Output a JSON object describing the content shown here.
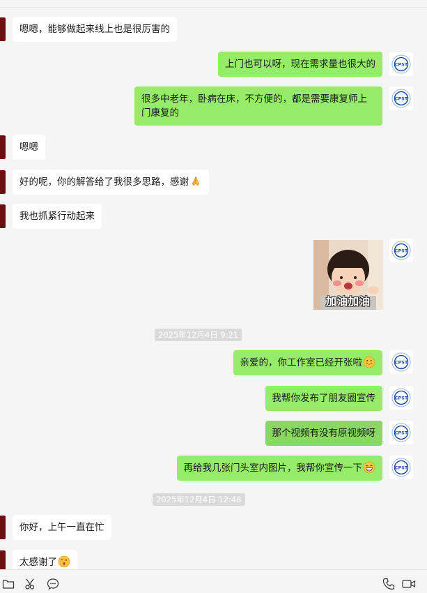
{
  "messages": {
    "m1": "嗯嗯，能够做起来线上也是很厉害的",
    "m2": "上门也可以呀，现在需求量也很大的",
    "m3": "很多中老年，卧病在床，不方便的，都是需要康复师上门康复的",
    "m4": "嗯嗯",
    "m5": "好的呢，你的解答给了我很多思路，感谢",
    "m6": "我也抓紧行动起来",
    "m7": "亲爱的，你工作室已经开张啦",
    "m8": "我帮你发布了朋友圈宣传",
    "m9": "那个视频有没有原视频呀",
    "m10": "再给我几张门头室内图片，我帮你宣传一下",
    "m11": "你好，上午一直在忙",
    "m12": "太感谢了"
  },
  "sticker": {
    "caption": "加油加油"
  },
  "timestamps": {
    "t1": "2025年12月4日 9:21",
    "t2": "2025年12月4日 12:48"
  },
  "avatar_logo_text": "CPST",
  "icons": [
    "folder-icon",
    "scissors-icon",
    "chat-bubble-icon",
    "phone-icon",
    "video-call-icon"
  ],
  "colors": {
    "outgoing_bubble": "#95ec69",
    "incoming_bubble": "#ffffff",
    "background": "#f5f5f5"
  }
}
